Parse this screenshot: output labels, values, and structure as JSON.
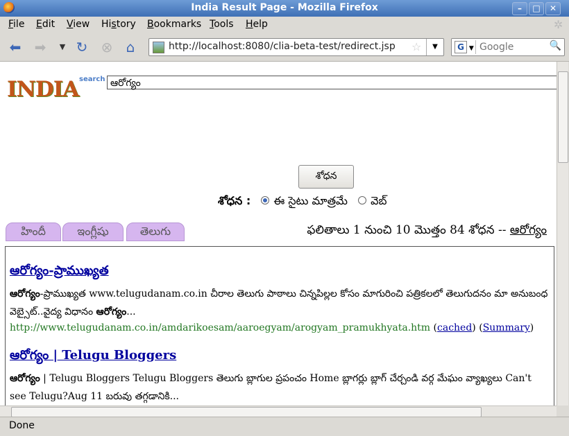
{
  "window": {
    "title": "India Result Page - Mozilla Firefox"
  },
  "menu": [
    "File",
    "Edit",
    "View",
    "History",
    "Bookmarks",
    "Tools",
    "Help"
  ],
  "menu_accel": [
    "F",
    "E",
    "V",
    "s",
    "B",
    "T",
    "H"
  ],
  "nav": {
    "url": "http://localhost:8080/clia-beta-test/redirect.jsp",
    "search_placeholder": "Google"
  },
  "page": {
    "logo_text": "INDIA",
    "logo_sub": "search",
    "query": "ఆరోగ్యం",
    "search_button": "శోధన",
    "scope_label": "శోధన :",
    "scope_site": "ఈ సైటు మాత్రమే",
    "scope_web": "వెబ్",
    "tabs": [
      "హిందీ",
      "ఇంగ్లీషు",
      "తెలుగు"
    ],
    "result_info": "ఫలితాలు 1 నుంచి 10 మొత్తం 84 శోధన --",
    "result_query": "ఆరోగ్యం",
    "results": [
      {
        "title": "ఆరోగ్యం-ప్రాముఖ్యత",
        "snippet_bold": "ఆరోగ్యం",
        "snippet": "-ప్రాముఖ్యత www.telugudanam.co.in చీరాల తెలుగు పాఠాలు చిన్నపిల్లల కోసం మాగురించి పత్రికలలో తెలుగుదనం మా అనుబంధ వెబ్సైట్..వైద్య విధానం",
        "snippet_bold2": "ఆరోగ్యం",
        "snippet_end": "...",
        "url": "http://www.telugudanam.co.in/amdarikoesam/aaroegyam/arogyam_pramukhyata.htm",
        "cached": "cached",
        "summary": "Summary"
      },
      {
        "title": "ఆరోగ్యం | Telugu Bloggers",
        "snippet_bold": "ఆరోగ్యం",
        "snippet": "| Telugu Bloggers Telugu Bloggers తెలుగు బ్లాగుల ప్రపంచం Home బ్లాగర్లు బ్లాగ్ చేర్చండి వర్గ మేఘం వ్యాఖ్యలు Can't see Telugu?Aug 11 బరువు తగ్గడానికి..."
      }
    ]
  },
  "status": {
    "text": "Done"
  }
}
